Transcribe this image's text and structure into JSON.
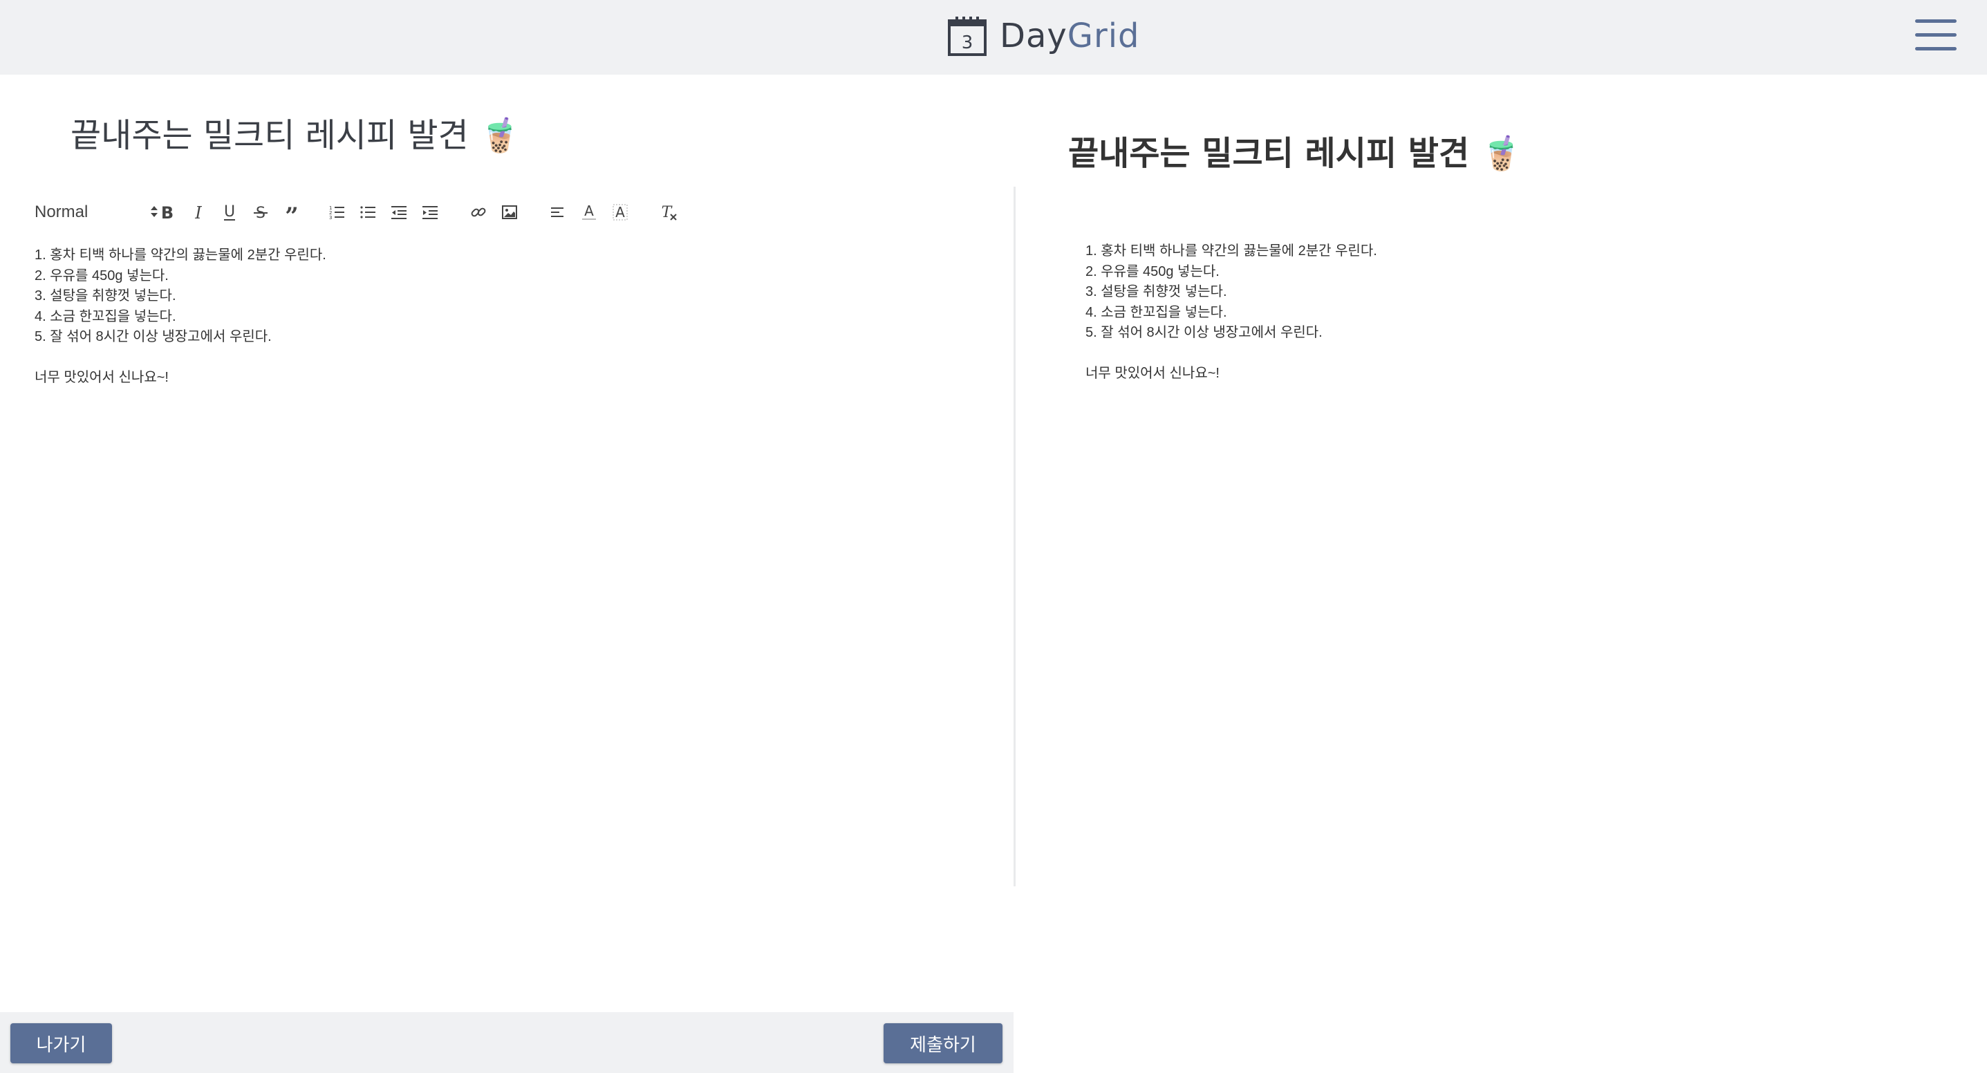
{
  "header": {
    "logo_day": "Day",
    "logo_grid": "Grid",
    "logo_calendar_day": "3",
    "menu_icon": "hamburger-menu-icon"
  },
  "editor": {
    "title_value": "끝내주는 밀크티 레시피 발견 🧋",
    "format_select": "Normal",
    "toolbar_icons": [
      "bold-icon",
      "italic-icon",
      "underline-icon",
      "strike-icon",
      "blockquote-icon",
      "ordered-list-icon",
      "bullet-list-icon",
      "outdent-icon",
      "indent-icon",
      "link-icon",
      "image-icon",
      "align-icon",
      "text-color-icon",
      "background-color-icon",
      "clear-format-icon"
    ],
    "lines": [
      "1. 홍차 티백 하나를 약간의 끓는물에 2분간 우린다.",
      "2. 우유를 450g 넣는다.",
      "3. 설탕을 취향껏 넣는다.",
      "4. 소금 한꼬집을 넣는다.",
      "5. 잘 섞어 8시간 이상 냉장고에서 우린다."
    ],
    "closing": "너무 맛있어서 신나요~!"
  },
  "preview": {
    "title": "끝내주는 밀크티 레시피 발견 🧋",
    "lines": [
      "1. 홍차 티백 하나를 약간의 끓는물에 2분간 우린다.",
      "2. 우유를 450g 넣는다.",
      "3. 설탕을 취향껏 넣는다.",
      "4. 소금 한꼬집을 넣는다.",
      "5. 잘 섞어 8시간 이상 냉장고에서 우린다."
    ],
    "closing": "너무 맛있어서 신나요~!"
  },
  "footer": {
    "exit_label": "나가기",
    "submit_label": "제출하기"
  },
  "colors": {
    "accent": "#5a6f96",
    "header_bg": "#f0f1f3",
    "logo_dark": "#3a3f4a"
  }
}
